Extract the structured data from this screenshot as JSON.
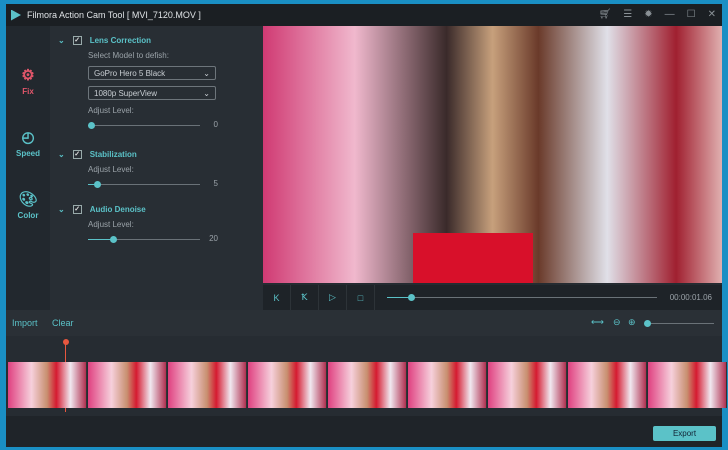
{
  "window": {
    "title": "Filmora Action Cam Tool  [ MVI_7120.MOV ]",
    "controls": [
      "cart-icon",
      "list-icon",
      "settings-icon",
      "minimize-icon",
      "maximize-icon",
      "close-icon"
    ]
  },
  "sidebar": {
    "items": [
      {
        "label": "Fix",
        "icon": "gear-icon"
      },
      {
        "label": "Speed",
        "icon": "speedometer-icon"
      },
      {
        "label": "Color",
        "icon": "palette-icon"
      }
    ]
  },
  "panel": {
    "lens": {
      "title": "Lens Correction",
      "model_label": "Select Model to defish:",
      "model": "GoPro Hero 5 Black",
      "mode": "1080p SuperView",
      "adjust_label": "Adjust Level:",
      "value": "0",
      "fraction": 0.03
    },
    "stab": {
      "title": "Stabilization",
      "adjust_label": "Adjust Level:",
      "value": "5",
      "fraction": 0.08
    },
    "audio": {
      "title": "Audio Denoise",
      "adjust_label": "Adjust Level:",
      "value": "20",
      "fraction": 0.22
    }
  },
  "player": {
    "time": "00:00:01.06",
    "progress": 0.09
  },
  "timeline": {
    "import": "Import",
    "clear": "Clear",
    "zoom": 0.02
  },
  "export": "Export",
  "colors": {
    "accent": "#5bc2c8",
    "frame": "#1a8fc4",
    "playhead": "#e8573f"
  }
}
